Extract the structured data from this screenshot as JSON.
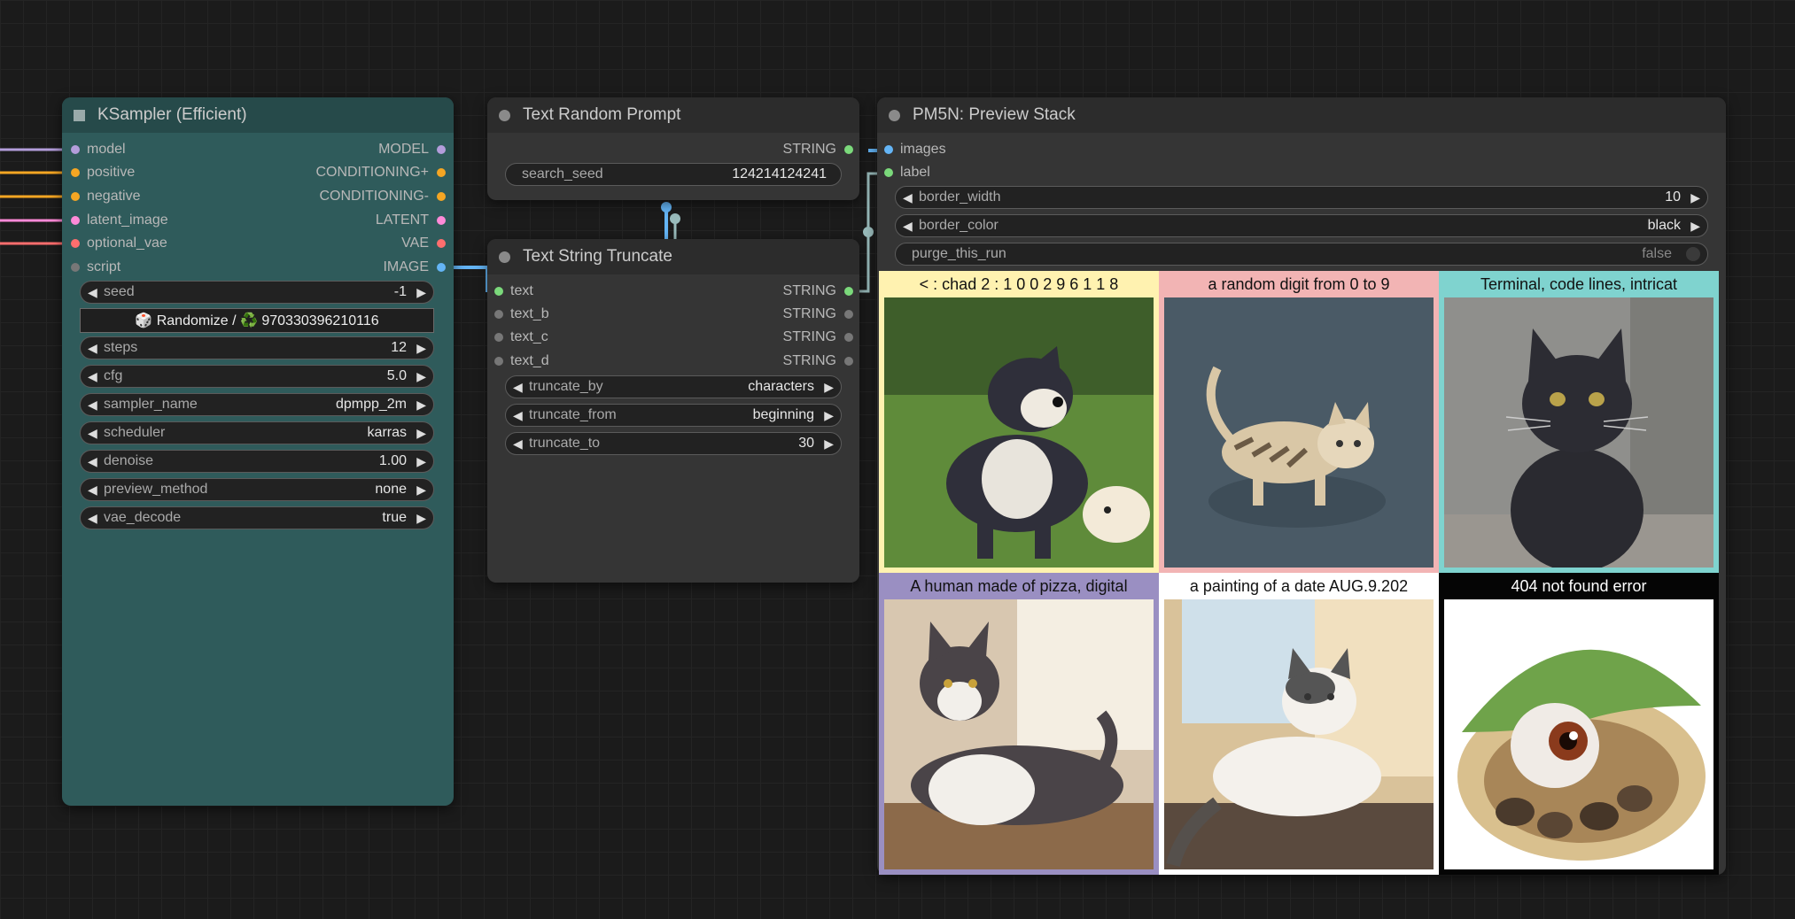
{
  "ksampler": {
    "title": "KSampler (Efficient)",
    "inputs": [
      "model",
      "positive",
      "negative",
      "latent_image",
      "optional_vae",
      "script"
    ],
    "outputs": [
      "MODEL",
      "CONDITIONING+",
      "CONDITIONING-",
      "LATENT",
      "VAE",
      "IMAGE"
    ],
    "seed_label": "seed",
    "seed_value": "-1",
    "randomize_label": "🎲 Randomize / ♻️ 970330396210116",
    "steps_label": "steps",
    "steps_value": "12",
    "cfg_label": "cfg",
    "cfg_value": "5.0",
    "sampler_label": "sampler_name",
    "sampler_value": "dpmpp_2m",
    "scheduler_label": "scheduler",
    "scheduler_value": "karras",
    "denoise_label": "denoise",
    "denoise_value": "1.00",
    "preview_label": "preview_method",
    "preview_value": "none",
    "vae_label": "vae_decode",
    "vae_value": "true"
  },
  "random_prompt": {
    "title": "Text Random Prompt",
    "output": "STRING",
    "seed_label": "search_seed",
    "seed_value": "124214124241"
  },
  "truncate": {
    "title": "Text String Truncate",
    "inputs": [
      "text",
      "text_b",
      "text_c",
      "text_d"
    ],
    "outputs": [
      "STRING",
      "STRING",
      "STRING",
      "STRING"
    ],
    "by_label": "truncate_by",
    "by_value": "characters",
    "from_label": "truncate_from",
    "from_value": "beginning",
    "to_label": "truncate_to",
    "to_value": "30"
  },
  "preview": {
    "title": "PM5N: Preview Stack",
    "inputs": [
      "images",
      "label"
    ],
    "bw_label": "border_width",
    "bw_value": "10",
    "bc_label": "border_color",
    "bc_value": "black",
    "purge_label": "purge_this_run",
    "purge_value": "false",
    "cells": [
      {
        "caption": "< : chad 2 : 1 0 0 2 9 6 1 1 8",
        "bg": "#fff2b0",
        "picture": "dog-and-puppy"
      },
      {
        "caption": "a random digit from 0 to 9",
        "bg": "#f2b4b4",
        "picture": "tabby-kitten"
      },
      {
        "caption": "Terminal, code lines, intricat",
        "bg": "#7fd3cf",
        "picture": "black-cat"
      },
      {
        "caption": "A human made of pizza, digital",
        "bg": "#9a8fc2",
        "picture": "lounging-cat"
      },
      {
        "caption": "a painting of a date AUG.9.202",
        "bg": "#ffffff",
        "picture": "sunny-cat"
      },
      {
        "caption": "404 not found error",
        "bg": "#050505",
        "caption_color": "#ffffff",
        "picture": "leaf-creature"
      }
    ]
  },
  "colors": {
    "ksampler_body": "#2f5b5b",
    "ksampler_title": "#264a4a",
    "node_body": "#353535",
    "node_title": "#2c2c2c",
    "model": "#b39ddb",
    "conditioning": "#f5a623",
    "latent": "#ff8ad8",
    "vae": "#ff6e6e",
    "image": "#64b5f6",
    "string": "#7bd97b"
  }
}
